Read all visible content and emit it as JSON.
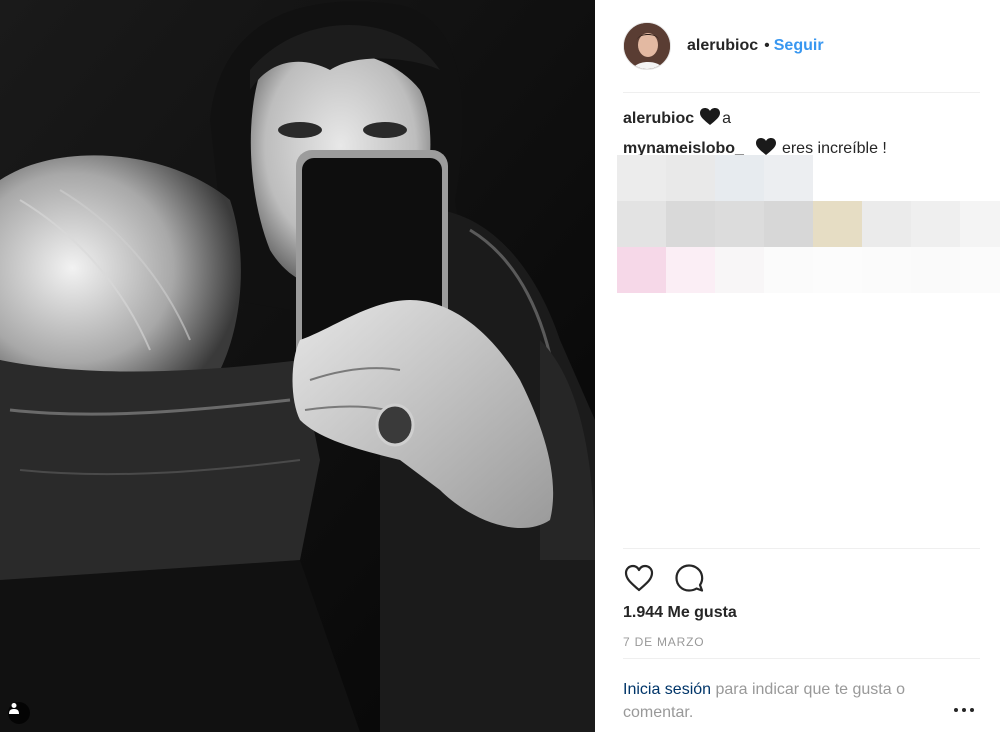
{
  "post": {
    "author": "alerubioc",
    "follow_label": "Seguir",
    "separator": "•"
  },
  "comments": [
    {
      "user": "alerubioc",
      "emoji": "black-heart",
      "text": "a"
    },
    {
      "user": "mynameislobo_",
      "emoji": "black-heart",
      "text": "eres increíble !"
    }
  ],
  "likes": "1.944 Me gusta",
  "date": "7 DE MARZO",
  "login_prompt": {
    "link": "Inicia sesión",
    "rest": "para indicar que te gusta o comentar."
  },
  "icons": {
    "like": "heart-outline-icon",
    "comment": "comment-bubble-icon",
    "tag": "user-tag-icon",
    "more": "more-options-icon"
  },
  "colors": {
    "link_blue": "#3897f0",
    "dark_link": "#003569",
    "muted": "#999999"
  }
}
